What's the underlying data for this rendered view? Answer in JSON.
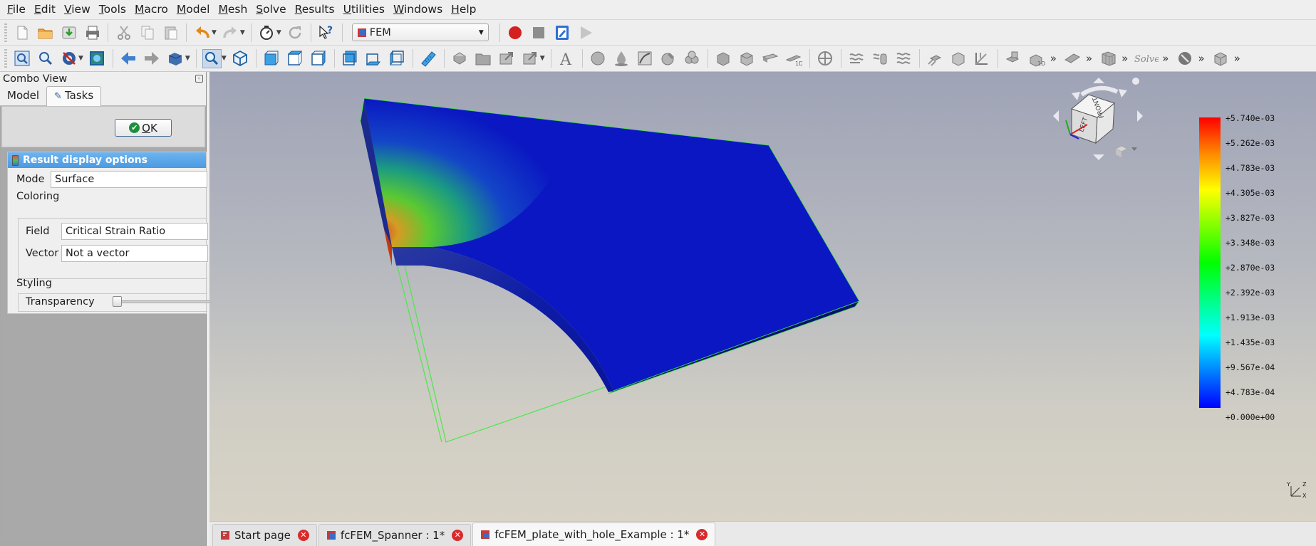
{
  "menu": [
    "File",
    "Edit",
    "View",
    "Tools",
    "Macro",
    "Model",
    "Mesh",
    "Solve",
    "Results",
    "Utilities",
    "Windows",
    "Help"
  ],
  "workbench": {
    "selected": "FEM"
  },
  "combo_view": {
    "title": "Combo View",
    "tabs": [
      "Model",
      "Tasks"
    ],
    "active_tab": "Tasks"
  },
  "task_panel": {
    "ok_label": "OK",
    "title": "Result display options",
    "mode_label": "Mode",
    "mode_value": "Surface",
    "coloring_label": "Coloring",
    "field_label": "Field",
    "field_value": "Critical Strain Ratio",
    "vector_label": "Vector",
    "vector_value": "Not a vector",
    "styling_label": "Styling",
    "transparency_label": "Transparency",
    "transparency_value": 0
  },
  "legend": {
    "labels": [
      "+5.740e-03",
      "+5.262e-03",
      "+4.783e-03",
      "+4.305e-03",
      "+3.827e-03",
      "+3.348e-03",
      "+2.870e-03",
      "+2.392e-03",
      "+1.913e-03",
      "+1.435e-03",
      "+9.567e-04",
      "+4.783e-04",
      "+0.000e+00"
    ],
    "max_color": "#ff0000",
    "min_color": "#0000ff"
  },
  "navcube": {
    "faces": [
      "LEFT",
      "FRONT"
    ]
  },
  "axis_labels": {
    "y": "Y",
    "z": "Z",
    "x": "X"
  },
  "document_tabs": [
    {
      "label": "Start page",
      "active": false
    },
    {
      "label": "fcFEM_Spanner : 1*",
      "active": false
    },
    {
      "label": "fcFEM_plate_with_hole_Example : 1*",
      "active": true
    }
  ],
  "colors": {
    "mesh_blue": "#0a17c2",
    "selection_edge": "#4ae84a",
    "panel_header": "#4a9ae2"
  }
}
